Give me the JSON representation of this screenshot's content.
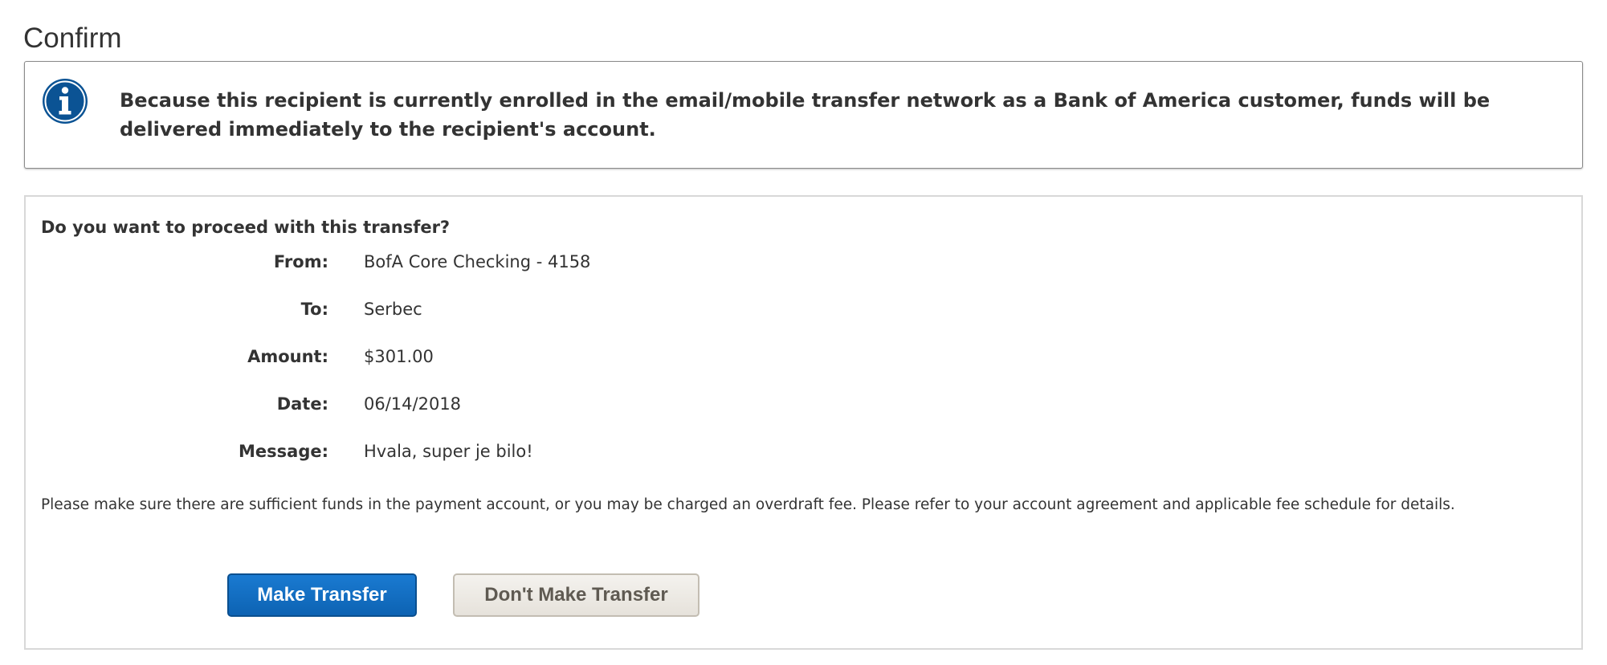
{
  "page": {
    "title": "Confirm"
  },
  "notice": {
    "icon": "info-icon",
    "icon_color": "#0b5394",
    "text": "Because this recipient is currently enrolled in the email/mobile transfer network as a Bank of America customer, funds will be delivered immediately to the recipient's account."
  },
  "confirmation": {
    "heading": "Do you want to proceed with this transfer?",
    "details": [
      {
        "label": "From:",
        "value": "BofA Core Checking - 4158"
      },
      {
        "label": "To:",
        "value": "Serbec"
      },
      {
        "label": "Amount:",
        "value": "$301.00"
      },
      {
        "label": "Date:",
        "value": "06/14/2018"
      },
      {
        "label": "Message:",
        "value": "Hvala, super je bilo!"
      }
    ],
    "disclaimer": "Please make sure there are sufficient funds in the payment account, or you may be charged an overdraft fee. Please refer to your account agreement and applicable fee schedule for details."
  },
  "actions": {
    "make_transfer_label": "Make Transfer",
    "dont_make_transfer_label": "Don't Make Transfer",
    "primary_color": "#0d6cc0"
  }
}
